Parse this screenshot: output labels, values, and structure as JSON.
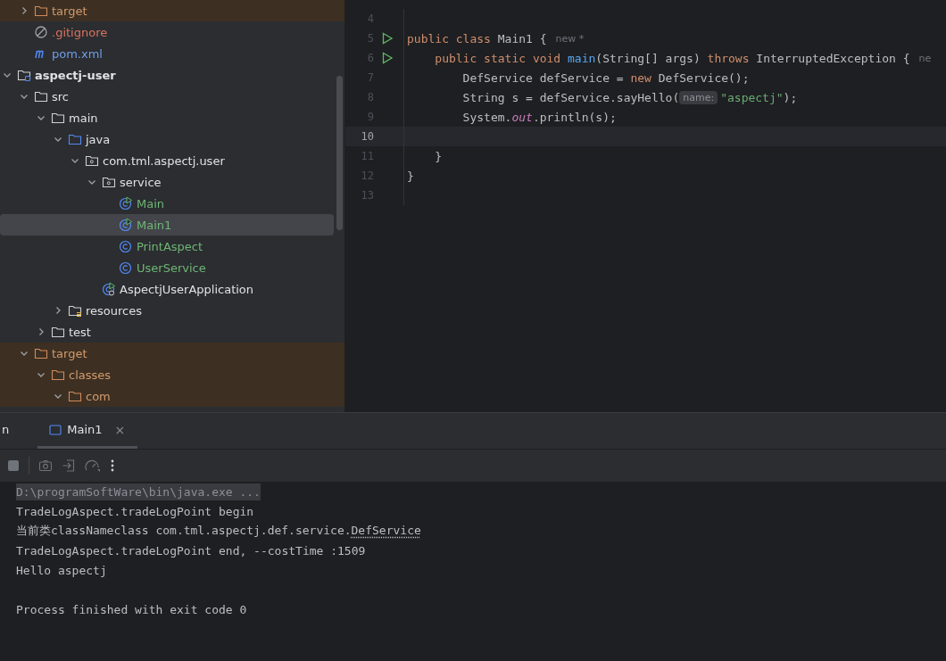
{
  "tree": {
    "items": [
      {
        "children": [
          {
            "label": "target",
            "kind": "folder",
            "excluded": true,
            "color": "#d29a6d",
            "expanded": false,
            "selected": false
          },
          {
            "label": ".gitignore",
            "kind": "ignore",
            "color": "#d9735f",
            "selected": false
          },
          {
            "label": "pom.xml",
            "kind": "maven",
            "color": "#6f9ee8",
            "selected": false
          }
        ]
      },
      {
        "label": "aspectj-user",
        "kind": "module",
        "color": "#dfe1e5",
        "expanded": true,
        "selected": false,
        "children": [
          {
            "label": "src",
            "kind": "folder",
            "color": "#dfe1e5",
            "expanded": true,
            "selected": false,
            "children": [
              {
                "label": "main",
                "kind": "folder",
                "color": "#dfe1e5",
                "expanded": true,
                "selected": false,
                "children": [
                  {
                    "label": "java",
                    "kind": "source",
                    "color": "#dfe1e5",
                    "expanded": true,
                    "selected": false,
                    "children": [
                      {
                        "label": "com.tml.aspectj.user",
                        "kind": "package",
                        "color": "#dfe1e5",
                        "expanded": true,
                        "selected": false,
                        "children": [
                          {
                            "label": "service",
                            "kind": "package",
                            "color": "#dfe1e5",
                            "expanded": true,
                            "selected": false,
                            "children": [
                              {
                                "label": "Main",
                                "kind": "runclass",
                                "color": "#6fb575",
                                "selected": false
                              },
                              {
                                "label": "Main1",
                                "kind": "runclass",
                                "color": "#6fb575",
                                "selected": true
                              },
                              {
                                "label": "PrintAspect",
                                "kind": "class",
                                "color": "#6fb575",
                                "selected": false
                              },
                              {
                                "label": "UserService",
                                "kind": "class",
                                "color": "#6fb575",
                                "selected": false
                              }
                            ]
                          },
                          {
                            "label": "AspectjUserApplication",
                            "kind": "boot",
                            "color": "#dfe1e5",
                            "selected": false
                          }
                        ]
                      }
                    ]
                  },
                  {
                    "label": "resources",
                    "kind": "resources",
                    "color": "#dfe1e5",
                    "expanded": false,
                    "selected": false
                  }
                ]
              },
              {
                "label": "test",
                "kind": "folder",
                "color": "#dfe1e5",
                "expanded": false,
                "selected": false
              }
            ]
          },
          {
            "label": "target",
            "kind": "folder",
            "excluded": true,
            "color": "#d29a6d",
            "expanded": true,
            "selected": false,
            "children": [
              {
                "label": "classes",
                "kind": "folder",
                "excluded": true,
                "color": "#d29a6d",
                "expanded": true,
                "selected": false,
                "children": [
                  {
                    "label": "com",
                    "kind": "folder",
                    "excluded": true,
                    "color": "#d29a6d",
                    "expanded": true,
                    "selected": false
                  }
                ]
              }
            ]
          }
        ]
      }
    ]
  },
  "editor": {
    "lines": [
      {
        "number": "4"
      },
      {
        "number": "5",
        "run": true,
        "tokens": [
          {
            "kind": "kw",
            "text": "public class "
          },
          {
            "kind": "plain",
            "text": "Main1 {"
          },
          {
            "kind": "author",
            "text": "new *"
          }
        ]
      },
      {
        "number": "6",
        "run": true,
        "tokens": [
          {
            "kind": "kw",
            "text": "    public static void "
          },
          {
            "kind": "fn",
            "text": "main"
          },
          {
            "kind": "plain",
            "text": "(String[] args) "
          },
          {
            "kind": "kw",
            "text": "throws "
          },
          {
            "kind": "plain",
            "text": "InterruptedException {"
          },
          {
            "kind": "author",
            "text": "ne"
          }
        ]
      },
      {
        "number": "7",
        "tokens": [
          {
            "kind": "plain",
            "text": "        DefService defService = "
          },
          {
            "kind": "kw",
            "text": "new "
          },
          {
            "kind": "plain",
            "text": "DefService();"
          }
        ]
      },
      {
        "number": "8",
        "tokens": [
          {
            "kind": "plain",
            "text": "        String s = defService.sayHello("
          },
          {
            "kind": "hint",
            "text": "name:"
          },
          {
            "kind": "str",
            "text": "\"aspectj\""
          },
          {
            "kind": "plain",
            "text": ");"
          }
        ]
      },
      {
        "number": "9",
        "tokens": [
          {
            "kind": "plain",
            "text": "        System."
          },
          {
            "kind": "field",
            "text": "out"
          },
          {
            "kind": "plain",
            "text": ".println(s);"
          }
        ]
      },
      {
        "number": "10",
        "current": true
      },
      {
        "number": "11",
        "tokens": [
          {
            "kind": "plain",
            "text": "    }"
          }
        ]
      },
      {
        "number": "12",
        "tokens": [
          {
            "kind": "plain",
            "text": "}"
          }
        ]
      },
      {
        "number": "13"
      }
    ]
  },
  "run_panel": {
    "tabs": [
      {
        "label": "n",
        "selected": false
      },
      {
        "label": "Main1",
        "selected": true,
        "close": "×"
      }
    ],
    "console": [
      {
        "kind": "command",
        "text": "D:\\programSoftWare\\bin\\java.exe ..."
      },
      {
        "kind": "output",
        "text": "TradeLogAspect.tradeLogPoint begin"
      },
      {
        "kind": "output",
        "text": "当前类classNameclass com.tml.aspectj.def.service.",
        "link": "DefService"
      },
      {
        "kind": "output",
        "text": "TradeLogAspect.tradeLogPoint end, --costTime :1509"
      },
      {
        "kind": "output",
        "text": "Hello aspectj"
      }
    ],
    "exit_message": "Process finished with exit code 0"
  }
}
